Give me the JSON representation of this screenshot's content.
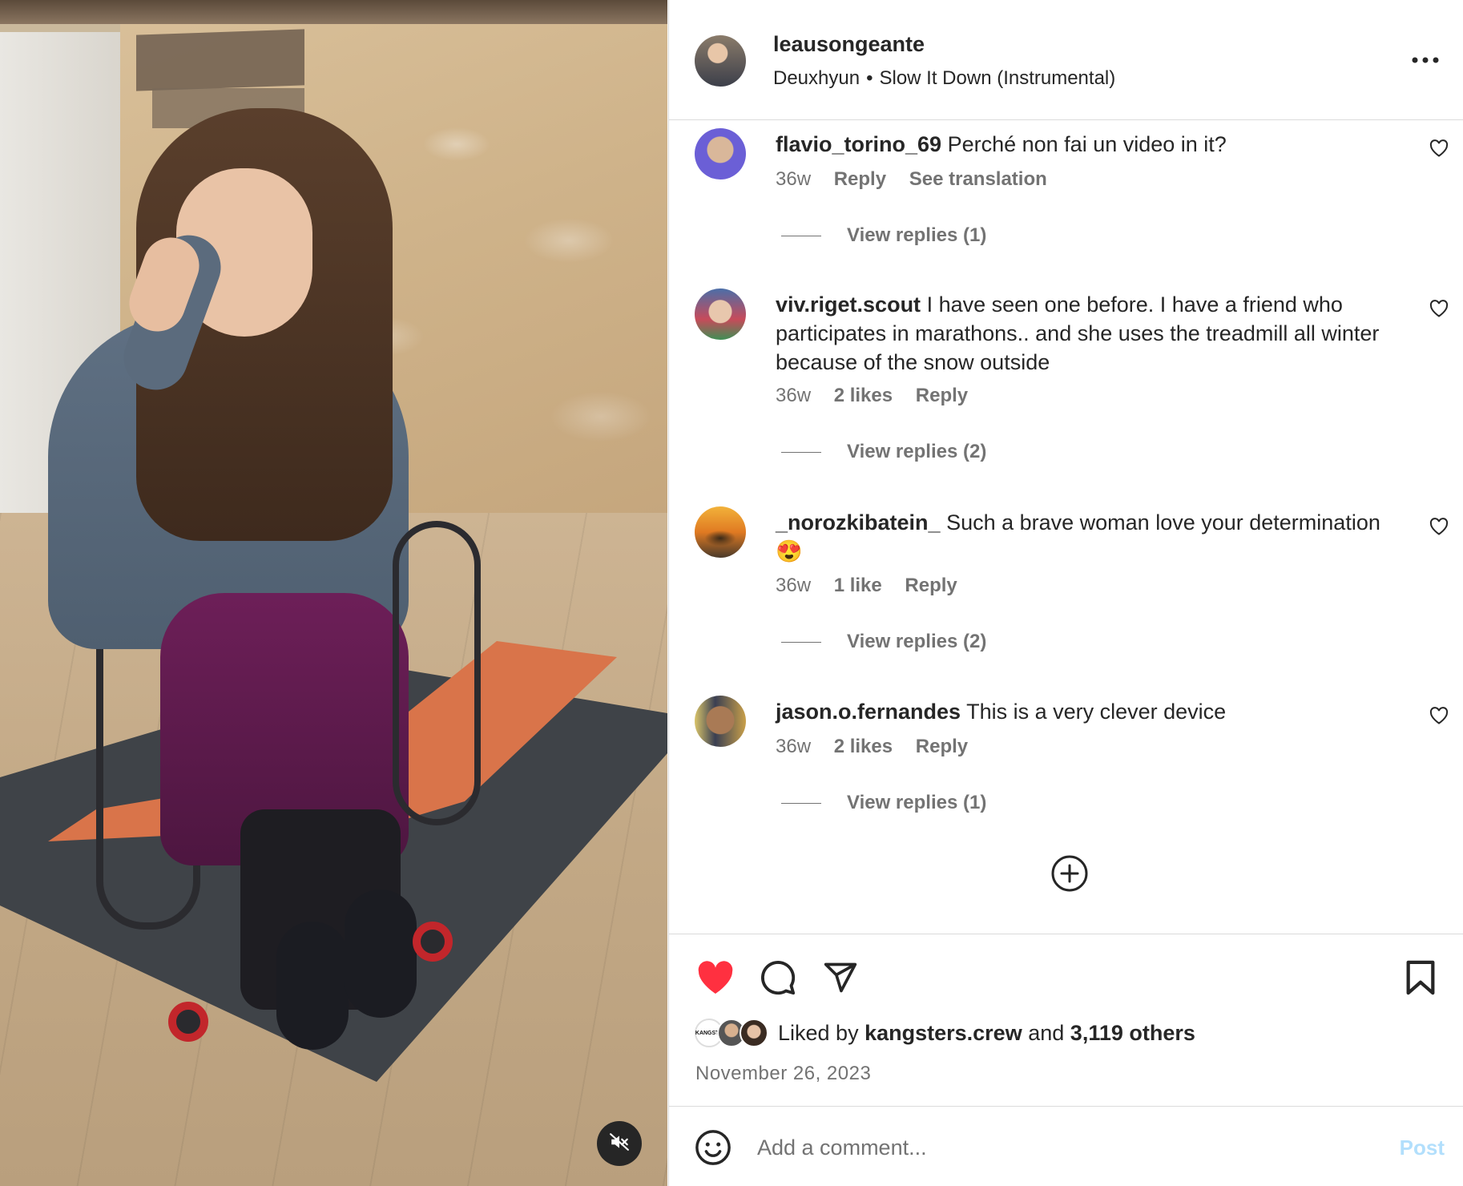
{
  "post": {
    "username": "leausongeante",
    "audio_artist": "Deuxhyun",
    "audio_separator": "•",
    "audio_title": "Slow It Down (Instrumental)"
  },
  "comments": [
    {
      "username": "flavio_torino_69",
      "text": "Perché non fai un video in it?",
      "age": "36w",
      "likes": "",
      "reply_label": "Reply",
      "translate_label": "See translation",
      "view_replies": "View replies (1)"
    },
    {
      "username": "viv.riget.scout",
      "text": "I have seen one before. I have a friend who participates in marathons.. and she uses the treadmill all winter because of the snow outside",
      "age": "36w",
      "likes": "2 likes",
      "reply_label": "Reply",
      "view_replies": "View replies (2)"
    },
    {
      "username": "_norozkibatein_",
      "text": "Such a brave woman love your determination 😍",
      "age": "36w",
      "likes": "1 like",
      "reply_label": "Reply",
      "view_replies": "View replies (2)"
    },
    {
      "username": "jason.o.fernandes",
      "text": "This is a very clever device",
      "age": "36w",
      "likes": "2 likes",
      "reply_label": "Reply",
      "view_replies": "View replies (1)"
    }
  ],
  "engagement": {
    "liked_by_prefix": "Liked by",
    "liked_by_user": "kangsters.crew",
    "and_word": "and",
    "others_count": "3,119 others",
    "date": "November 26, 2023",
    "mini_avatar_label": "KANGSTE"
  },
  "composer": {
    "placeholder": "Add a comment...",
    "post_label": "Post"
  },
  "icons": {
    "like_active": "heart-filled-icon",
    "comment": "speech-bubble-icon",
    "share": "paper-plane-icon",
    "save": "bookmark-icon",
    "more": "ellipsis-icon",
    "mute": "speaker-muted-icon",
    "load_more": "plus-circle-icon",
    "emoji": "smiley-icon"
  },
  "colors": {
    "like_red": "#ff3040",
    "text_primary": "#262626",
    "text_secondary": "#737373",
    "post_disabled": "#b2dffc",
    "divider": "#dbdbdb"
  }
}
